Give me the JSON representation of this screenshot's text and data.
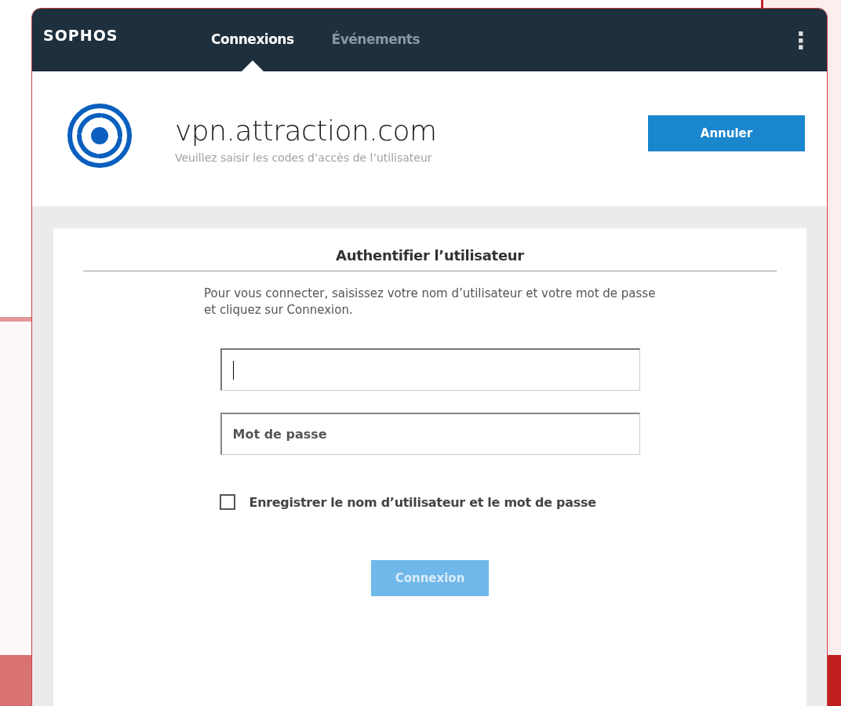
{
  "app": {
    "logo": "SOPHOS",
    "menu": "⋮"
  },
  "tabs": [
    {
      "label": "Connexions",
      "selected": true
    },
    {
      "label": "Événements",
      "selected": false
    }
  ],
  "connection": {
    "name": "vpn.attraction.com",
    "subtitle": "Veuillez saisir les codes d’accès de l’utilisateur",
    "cancel_button": "Annuler"
  },
  "auth": {
    "title": "Authentifier l’utilisateur",
    "instructions": "Pour vous connecter, saisissez votre nom d’utilisateur et votre mot de passe et cliquez sur Connexion.",
    "username": {
      "focused": true
    },
    "password": {
      "placeholder": "Mot de passe"
    },
    "remember": {
      "label": "Enregistrer le nom d’utilisateur et le mot de passe",
      "checked": false
    },
    "submit": {
      "label": "Connexion",
      "disabled": true
    }
  }
}
